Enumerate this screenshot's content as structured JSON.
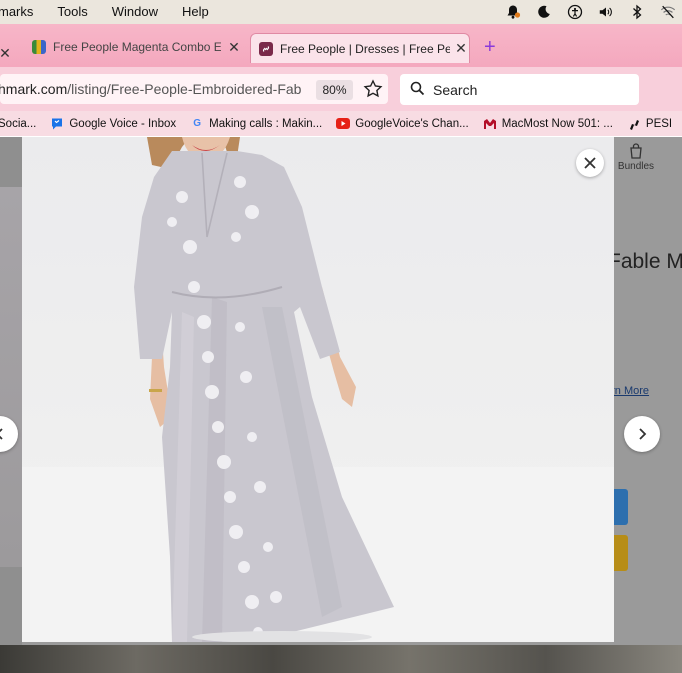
{
  "menubar": {
    "items": [
      "marks",
      "Tools",
      "Window",
      "Help"
    ]
  },
  "tabs": [
    {
      "title": "Free People Magenta Combo Em",
      "active": false,
      "favicon": "shopping-bag-icon"
    },
    {
      "title": "Free People | Dresses | Free Peo",
      "active": true,
      "favicon": "link-icon"
    }
  ],
  "urlbar": {
    "domain": "hmark.com",
    "path": "/listing/Free-People-Embroidered-Fab",
    "zoom": "80%"
  },
  "search": {
    "placeholder": "Search"
  },
  "bookmarks": [
    {
      "label": "Socia...",
      "icon": "generic-icon"
    },
    {
      "label": "Google Voice - Inbox",
      "icon": "google-voice-icon"
    },
    {
      "label": "Making calls : Makin...",
      "icon": "google-icon"
    },
    {
      "label": "GoogleVoice's Chan...",
      "icon": "youtube-icon"
    },
    {
      "label": "MacMost Now 501: ...",
      "icon": "macmost-icon"
    },
    {
      "label": "PESI",
      "icon": "pesi-icon"
    }
  ],
  "page": {
    "bundles_label": "Bundles",
    "title_fragment": "Fable M",
    "learn_more": "arn More"
  },
  "colors": {
    "tabstrip": "#f4a8be",
    "accent_blue": "#2d6fae",
    "accent_yellow": "#b78d17",
    "dress": "#c9c7cf"
  }
}
